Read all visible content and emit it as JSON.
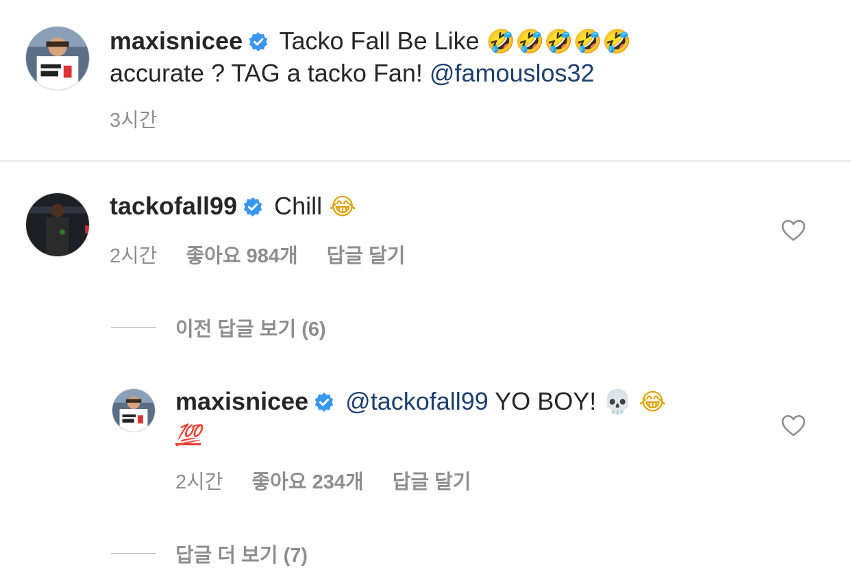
{
  "caption": {
    "username": "maxisnicee",
    "text_line1": "Tacko Fall Be Like",
    "emojis": [
      "🤣",
      "🤣",
      "🤣",
      "🤣",
      "🤣"
    ],
    "text_line2": "accurate ? TAG a tacko Fan!",
    "mention": "@famouslos32",
    "time": "3시간"
  },
  "comments": [
    {
      "username": "tackofall99",
      "text": "Chill",
      "emoji": "😂",
      "time": "2시간",
      "likes": "좋아요 984개",
      "reply_label": "답글 달기"
    }
  ],
  "view_previous_replies": "이전 답글 보기 (6)",
  "reply": {
    "username": "maxisnicee",
    "mention": "@tackofall99",
    "text": "YO BOY!",
    "emoji_skull": "💀",
    "emoji_laugh": "😂",
    "emoji_hundred": "💯",
    "time": "2시간",
    "likes": "좋아요 234개",
    "reply_label": "답글 달기"
  },
  "view_more_replies": "답글 더 보기 (7)",
  "colors": {
    "text": "#262626",
    "muted": "#8e8e8e",
    "mention": "#1c3f6e",
    "verified": "#3897f0"
  }
}
